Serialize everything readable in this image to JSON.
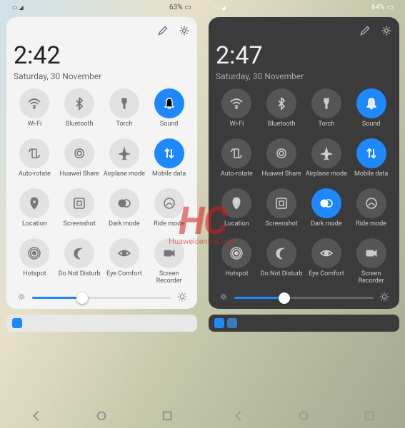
{
  "watermark": {
    "big": "HC",
    "small": "Huaweicentral.com"
  },
  "light": {
    "status": {
      "battery": "63%"
    },
    "time": "2:42",
    "date": "Saturday, 30 November",
    "tiles": [
      {
        "label": "Wi-Fi",
        "icon": "wifi",
        "active": false
      },
      {
        "label": "Bluetooth",
        "icon": "bluetooth",
        "active": false
      },
      {
        "label": "Torch",
        "icon": "torch",
        "active": false
      },
      {
        "label": "Sound",
        "icon": "bell",
        "active": true
      },
      {
        "label": "Auto-rotate",
        "icon": "rotate",
        "active": false
      },
      {
        "label": "Huawei Share",
        "icon": "share",
        "active": false
      },
      {
        "label": "Airplane mode",
        "icon": "airplane",
        "active": false
      },
      {
        "label": "Mobile data",
        "icon": "data",
        "active": true
      },
      {
        "label": "Location",
        "icon": "location",
        "active": false
      },
      {
        "label": "Screenshot",
        "icon": "screenshot",
        "active": false
      },
      {
        "label": "Dark mode",
        "icon": "darkmode",
        "active": false
      },
      {
        "label": "Ride mode",
        "icon": "ride",
        "active": false
      },
      {
        "label": "Hotspot",
        "icon": "hotspot",
        "active": false
      },
      {
        "label": "Do Not Disturb",
        "icon": "dnd",
        "active": false
      },
      {
        "label": "Eye Comfort",
        "icon": "eye",
        "active": false
      },
      {
        "label": "Screen Recorder",
        "icon": "record",
        "active": false
      }
    ],
    "brightness": 36
  },
  "dark": {
    "status": {
      "battery": "64%"
    },
    "time": "2:47",
    "date": "Saturday, 30 November",
    "tiles": [
      {
        "label": "Wi-Fi",
        "icon": "wifi",
        "active": false
      },
      {
        "label": "Bluetooth",
        "icon": "bluetooth",
        "active": false
      },
      {
        "label": "Torch",
        "icon": "torch",
        "active": false
      },
      {
        "label": "Sound",
        "icon": "bell",
        "active": true
      },
      {
        "label": "Auto-rotate",
        "icon": "rotate",
        "active": false
      },
      {
        "label": "Huawei Share",
        "icon": "share",
        "active": false
      },
      {
        "label": "Airplane mode",
        "icon": "airplane",
        "active": false
      },
      {
        "label": "Mobile data",
        "icon": "data",
        "active": true
      },
      {
        "label": "Location",
        "icon": "location",
        "active": false
      },
      {
        "label": "Screenshot",
        "icon": "screenshot",
        "active": false
      },
      {
        "label": "Dark mode",
        "icon": "darkmode",
        "active": true
      },
      {
        "label": "Ride mode",
        "icon": "ride",
        "active": false
      },
      {
        "label": "Hotspot",
        "icon": "hotspot",
        "active": false
      },
      {
        "label": "Do Not Disturb",
        "icon": "dnd",
        "active": false
      },
      {
        "label": "Eye Comfort",
        "icon": "eye",
        "active": false
      },
      {
        "label": "Screen Recorder",
        "icon": "record",
        "active": false
      }
    ],
    "brightness": 36
  }
}
